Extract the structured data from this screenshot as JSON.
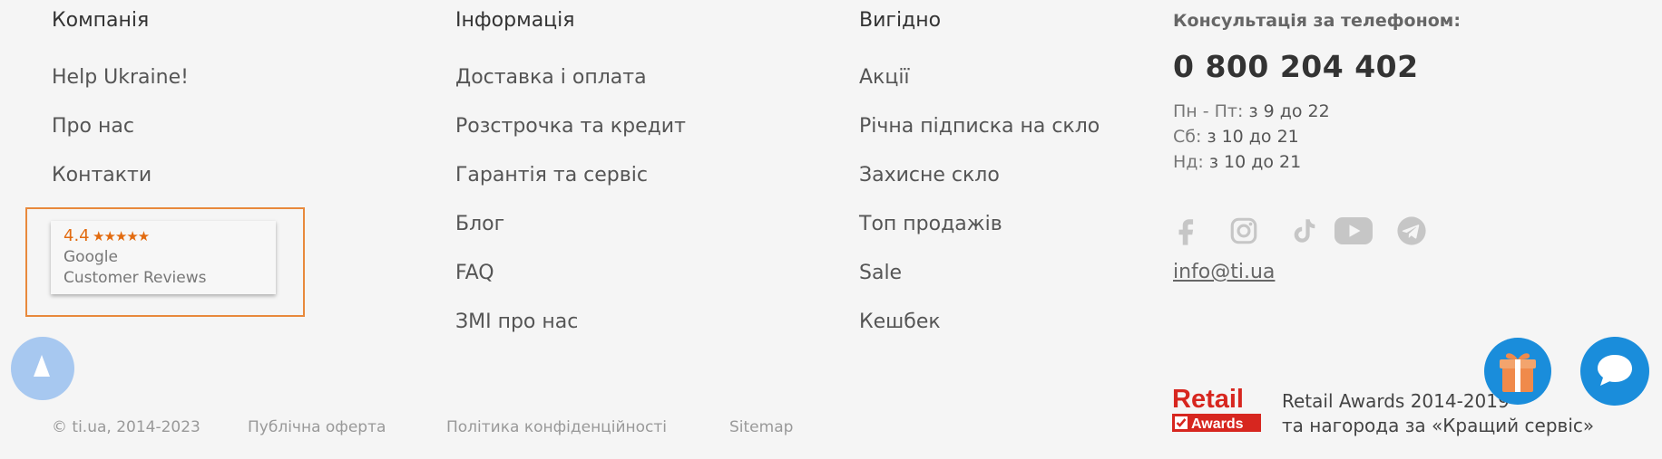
{
  "footer": {
    "company": {
      "title": "Компанія",
      "links": [
        "Help Ukraine!",
        "Про нас",
        "Контакти"
      ]
    },
    "info": {
      "title": "Інформація",
      "links": [
        "Доставка і оплата",
        "Розстрочка та кредит",
        "Гарантія та сервіс",
        "Блог",
        "FAQ",
        "ЗМІ про нас"
      ]
    },
    "benefit": {
      "title": "Вигідно",
      "links": [
        "Акції",
        "Річна підписка на скло",
        "Захисне скло",
        "Топ продажів",
        "Sale",
        "Кешбек"
      ]
    },
    "reviews": {
      "rating": "4.4",
      "line1": "Google",
      "line2": "Customer Reviews"
    },
    "contacts": {
      "title": "Консультація за телефоном:",
      "phone": "0 800 204 402",
      "hours": [
        {
          "label": "Пн - Пт:",
          "value": "з 9 до 22"
        },
        {
          "label": "Сб:",
          "value": "з 10 до 21"
        },
        {
          "label": "Нд:",
          "value": "з 10 до 21"
        }
      ],
      "email": "info@ti.ua"
    },
    "socials": [
      "facebook-icon",
      "instagram-icon",
      "tiktok-icon",
      "youtube-icon",
      "telegram-icon"
    ],
    "awards": {
      "logo_word1": "Retail",
      "logo_word2": "Awards",
      "line1": "Retail Awards 2014-2019",
      "line2": "та нагорода за «Кращий сервіс»"
    },
    "bottom": {
      "copyright": "© ti.ua, 2014-2023",
      "offer": "Публічна оферта",
      "privacy": "Політика конфіденційності",
      "sitemap": "Sitemap"
    }
  },
  "colors": {
    "background": "#f5f5f5",
    "accent_blue": "#1a8ddb",
    "review_orange": "#e26b10",
    "highlight_border": "#e8893c",
    "retail_red": "#d7261f"
  }
}
